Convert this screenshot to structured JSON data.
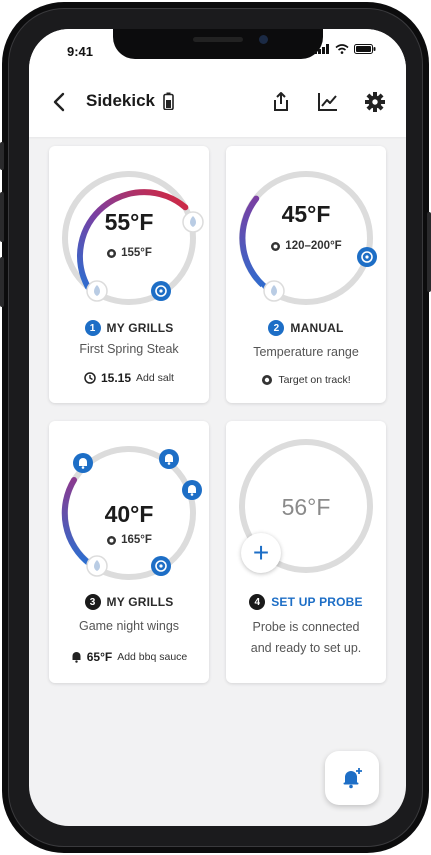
{
  "status_bar": {
    "time": "9:41"
  },
  "header": {
    "title": "Sidekick"
  },
  "probes": [
    {
      "temp": "55°F",
      "target": "155°F",
      "number": "1",
      "source": "MY GRILLS",
      "name": "First Spring Steak",
      "footer_value": "15.15",
      "footer_note": "Add salt"
    },
    {
      "temp": "45°F",
      "target": "120–200°F",
      "number": "2",
      "source": "MANUAL",
      "name": "Temperature range",
      "footer_note": "Target on track!"
    },
    {
      "temp": "40°F",
      "target": "165°F",
      "number": "3",
      "source": "MY GRILLS",
      "name": "Game night wings",
      "footer_value": "65°F",
      "footer_note": "Add bbq sauce"
    },
    {
      "temp": "56°F",
      "number": "4",
      "source": "SET UP PROBE",
      "name_line1": "Probe is connected",
      "name_line2": "and ready to set up."
    }
  ],
  "colors": {
    "accent": "#1d6ec6",
    "hot": "#d8263a",
    "cool": "#2b6fd1",
    "track": "#dcdcdc"
  }
}
